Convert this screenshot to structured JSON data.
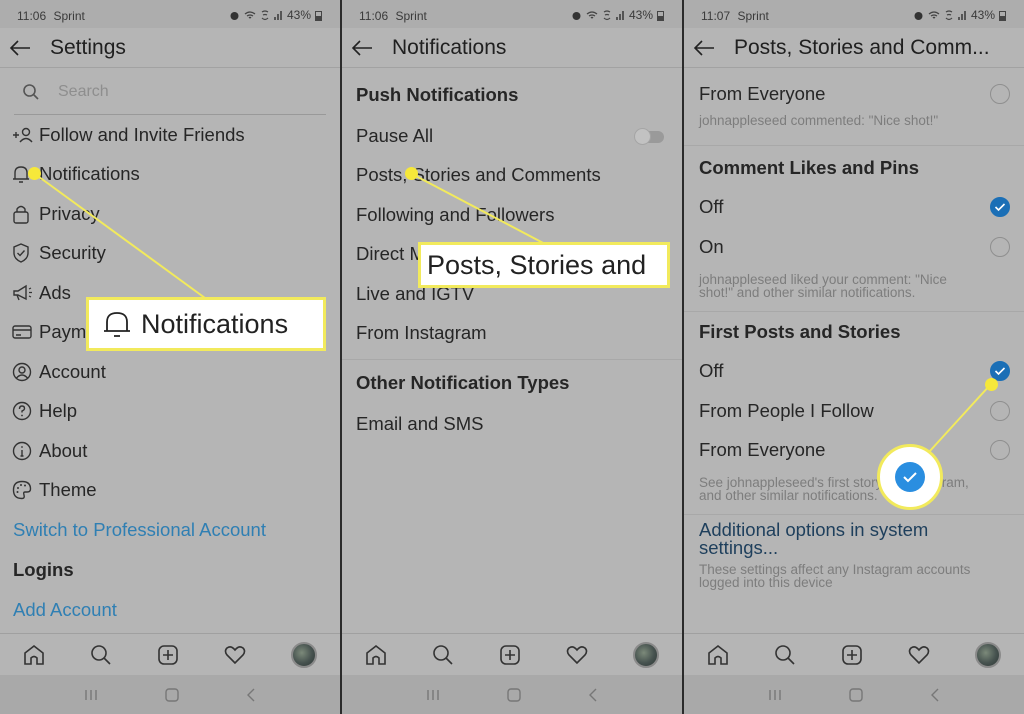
{
  "status_bar": [
    {
      "time": "11:06",
      "carrier": "Sprint",
      "battery": "43%"
    },
    {
      "time": "11:06",
      "carrier": "Sprint",
      "battery": "43%"
    },
    {
      "time": "11:07",
      "carrier": "Sprint",
      "battery": "43%"
    }
  ],
  "settings": {
    "title": "Settings",
    "search_placeholder": "Search",
    "items": [
      {
        "label": "Follow and Invite Friends",
        "icon": "add-person-icon"
      },
      {
        "label": "Notifications",
        "icon": "bell-icon"
      },
      {
        "label": "Privacy",
        "icon": "lock-icon"
      },
      {
        "label": "Security",
        "icon": "shield-icon"
      },
      {
        "label": "Ads",
        "icon": "megaphone-icon"
      },
      {
        "label": "Payments",
        "icon": "card-icon"
      },
      {
        "label": "Account",
        "icon": "account-icon"
      },
      {
        "label": "Help",
        "icon": "help-icon"
      },
      {
        "label": "About",
        "icon": "info-icon"
      },
      {
        "label": "Theme",
        "icon": "palette-icon"
      }
    ],
    "switch_professional": "Switch to Professional Account",
    "logins_heading": "Logins",
    "add_account": "Add Account",
    "callout": "Notifications"
  },
  "notifications": {
    "title": "Notifications",
    "push_heading": "Push Notifications",
    "pause_all": "Pause All",
    "pause_all_on": false,
    "items": [
      "Posts, Stories and Comments",
      "Following and Followers",
      "Direct Messages",
      "Live and IGTV",
      "From Instagram"
    ],
    "other_heading": "Other Notification Types",
    "other_items": [
      "Email and SMS"
    ],
    "callout": "Posts, Stories and"
  },
  "posts_stories": {
    "title": "Posts, Stories and Comm...",
    "top_option": {
      "label": "From Everyone",
      "selected": false
    },
    "top_desc": "johnappleseed commented: \"Nice shot!\"",
    "comment_likes": {
      "heading": "Comment Likes and Pins",
      "options": [
        {
          "label": "Off",
          "selected": true
        },
        {
          "label": "On",
          "selected": false
        }
      ],
      "desc": "johnappleseed liked your comment: \"Nice shot!\" and other similar notifications."
    },
    "first_posts": {
      "heading": "First Posts and Stories",
      "options": [
        {
          "label": "Off",
          "selected": true
        },
        {
          "label": "From People I Follow",
          "selected": false
        },
        {
          "label": "From Everyone",
          "selected": false
        }
      ],
      "desc": "See johnappleseed's first story on Instagram, and other similar notifications."
    },
    "additional_link": "Additional options in system settings...",
    "additional_desc": "These settings affect any Instagram accounts logged into this device"
  },
  "bottom_nav": [
    "home-icon",
    "search-icon",
    "new-post-icon",
    "activity-heart-icon",
    "profile-avatar"
  ],
  "colors": {
    "accent_blue": "#1b6fb6",
    "link_blue": "#2f7fb3",
    "highlight_yellow": "#f6e83a"
  }
}
